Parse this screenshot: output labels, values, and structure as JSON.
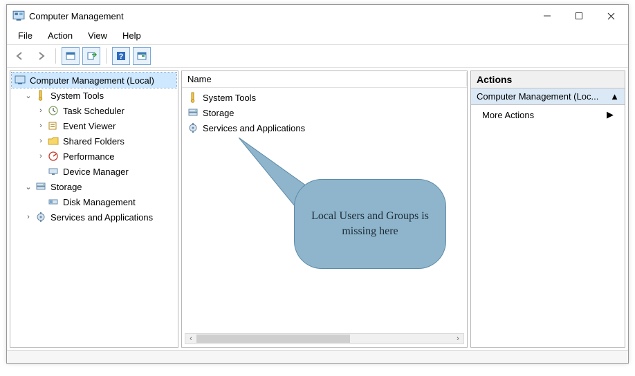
{
  "window": {
    "title": "Computer Management"
  },
  "menu": {
    "items": [
      "File",
      "Action",
      "View",
      "Help"
    ]
  },
  "toolbar": {
    "buttons": [
      "back",
      "forward",
      "up",
      "show-hide",
      "help",
      "refresh"
    ]
  },
  "tree": {
    "root": {
      "label": "Computer Management (Local)",
      "selected": true
    },
    "items": [
      {
        "label": "System Tools",
        "expanded": true,
        "level": 1,
        "icon": "wrench",
        "children": [
          {
            "label": "Task Scheduler",
            "level": 2,
            "icon": "clock",
            "expandable": true
          },
          {
            "label": "Event Viewer",
            "level": 2,
            "icon": "event",
            "expandable": true
          },
          {
            "label": "Shared Folders",
            "level": 2,
            "icon": "folder-share",
            "expandable": true
          },
          {
            "label": "Performance",
            "level": 2,
            "icon": "perf",
            "expandable": true
          },
          {
            "label": "Device Manager",
            "level": 2,
            "icon": "device",
            "expandable": false
          }
        ]
      },
      {
        "label": "Storage",
        "expanded": true,
        "level": 1,
        "icon": "storage",
        "children": [
          {
            "label": "Disk Management",
            "level": 2,
            "icon": "disk",
            "expandable": false
          }
        ]
      },
      {
        "label": "Services and Applications",
        "expanded": false,
        "level": 1,
        "icon": "services",
        "expandable": true
      }
    ]
  },
  "list": {
    "header": "Name",
    "rows": [
      {
        "label": "System Tools",
        "icon": "wrench"
      },
      {
        "label": "Storage",
        "icon": "storage"
      },
      {
        "label": "Services and Applications",
        "icon": "services"
      }
    ]
  },
  "actions": {
    "header": "Actions",
    "subheading": "Computer Management (Loc...",
    "item": "More Actions"
  },
  "callout": {
    "text": "Local Users and Groups is missing here"
  }
}
